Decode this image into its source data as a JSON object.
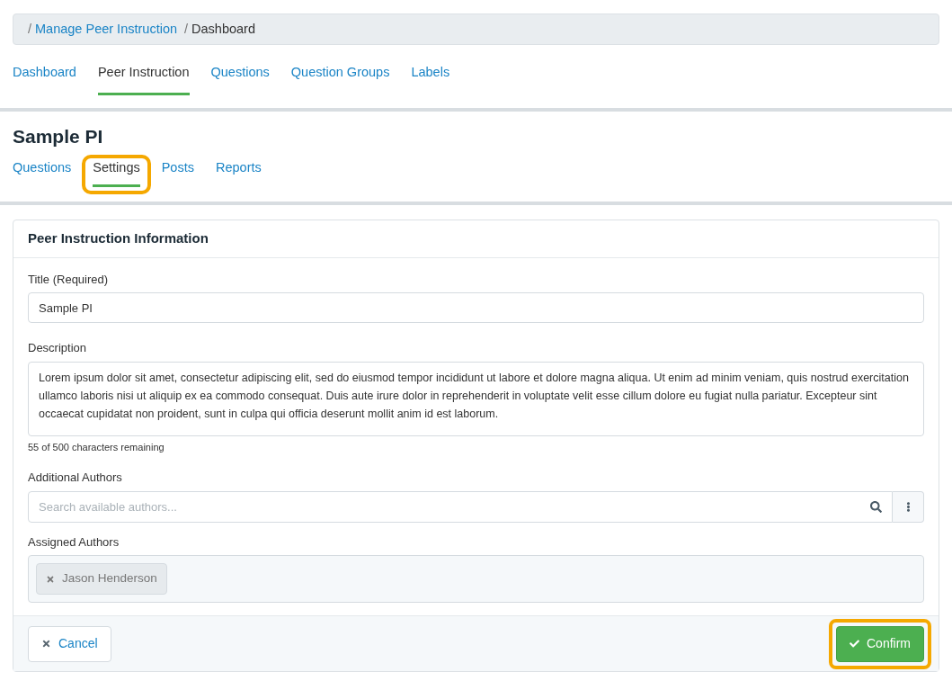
{
  "breadcrumb": [
    {
      "separator": "/",
      "label": "Manage Peer Instruction",
      "link": true
    },
    {
      "separator": "/",
      "label": "Dashboard",
      "link": false
    }
  ],
  "main_tabs": [
    {
      "label": "Dashboard",
      "selected": false
    },
    {
      "label": "Peer Instruction",
      "selected": true
    },
    {
      "label": "Questions",
      "selected": false
    },
    {
      "label": "Question Groups",
      "selected": false
    },
    {
      "label": "Labels",
      "selected": false
    }
  ],
  "page_title": "Sample PI",
  "sub_tabs": [
    {
      "label": "Questions",
      "selected": false,
      "highlighted": false
    },
    {
      "label": "Settings",
      "selected": true,
      "highlighted": true
    },
    {
      "label": "Posts",
      "selected": false,
      "highlighted": false
    },
    {
      "label": "Reports",
      "selected": false,
      "highlighted": false
    }
  ],
  "card": {
    "title": "Peer Instruction Information",
    "title_field": {
      "label": "Title (Required)",
      "value": "Sample PI"
    },
    "description_field": {
      "label": "Description",
      "value": "Lorem ipsum dolor sit amet, consectetur adipiscing elit, sed do eiusmod tempor incididunt ut labore et dolore magna aliqua. Ut enim ad minim veniam, quis nostrud exercitation ullamco laboris nisi ut aliquip ex ea commodo consequat. Duis aute irure dolor in reprehenderit in voluptate velit esse cillum dolore eu fugiat nulla pariatur. Excepteur sint occaecat cupidatat non proident, sunt in culpa qui officia deserunt mollit anim id est laborum.",
      "hint": "55 of 500 characters remaining"
    },
    "authors_search": {
      "label": "Additional Authors",
      "placeholder": "Search available authors..."
    },
    "assigned_authors": {
      "label": "Assigned Authors",
      "items": [
        "Jason Henderson"
      ]
    },
    "buttons": [
      {
        "kind": "cancel",
        "label": "Cancel",
        "highlighted": false
      },
      {
        "kind": "confirm",
        "label": "Confirm",
        "highlighted": true
      }
    ]
  }
}
